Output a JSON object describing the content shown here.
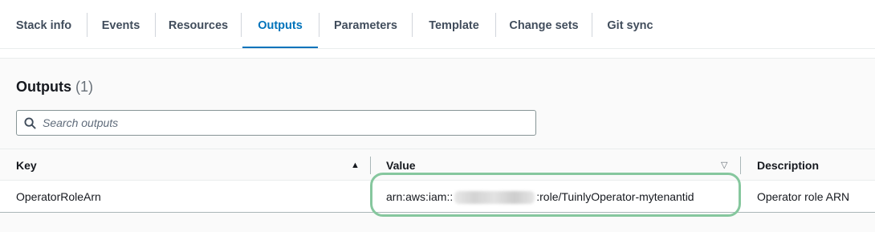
{
  "tabs": {
    "items": [
      {
        "label": "Stack info"
      },
      {
        "label": "Events"
      },
      {
        "label": "Resources"
      },
      {
        "label": "Outputs"
      },
      {
        "label": "Parameters"
      },
      {
        "label": "Template"
      },
      {
        "label": "Change sets"
      },
      {
        "label": "Git sync"
      }
    ],
    "active": "Outputs"
  },
  "outputs": {
    "title": "Outputs",
    "count": "(1)",
    "search": {
      "placeholder": "Search outputs",
      "value": ""
    },
    "columns": {
      "key": "Key",
      "value": "Value",
      "description": "Description"
    },
    "rows": [
      {
        "key": "OperatorRoleArn",
        "value_prefix": "arn:aws:iam::",
        "value_suffix": ":role/TuinlyOperator-mytenantid",
        "description": "Operator role ARN"
      }
    ]
  },
  "colors": {
    "accent": "#0073bb",
    "highlight_ring": "#86c79e",
    "text": "#16191f"
  },
  "icons": {
    "search": "search-icon",
    "sort_asc": "caret-up-icon",
    "sort_desc": "caret-down-icon"
  }
}
